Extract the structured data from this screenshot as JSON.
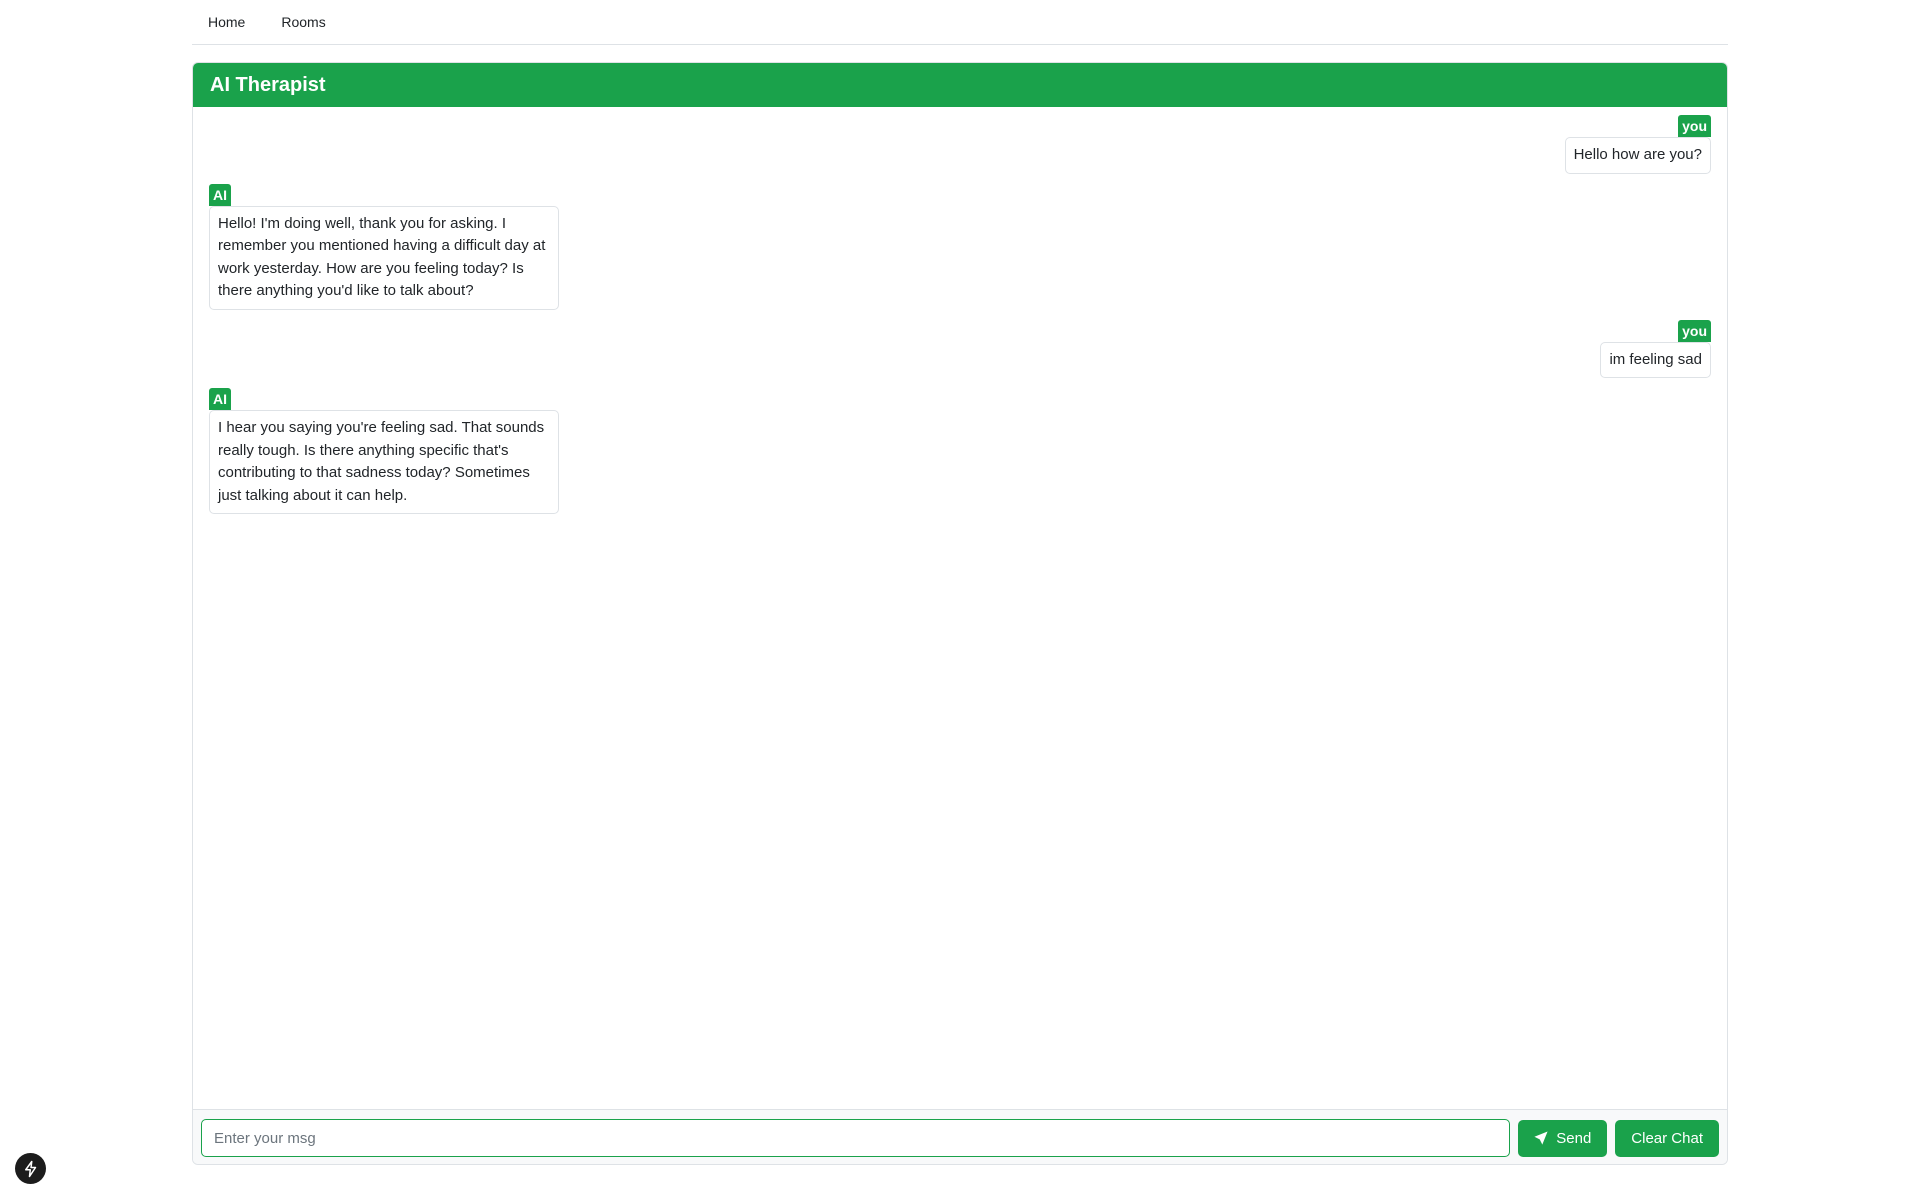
{
  "nav": {
    "items": [
      {
        "label": "Home"
      },
      {
        "label": "Rooms"
      }
    ]
  },
  "header": {
    "title": "AI Therapist"
  },
  "messages": [
    {
      "sender": "you",
      "text": "Hello how are you?"
    },
    {
      "sender": "AI",
      "text": "Hello! I'm doing well, thank you for asking. I remember you mentioned having a difficult day at work yesterday. How are you feeling today? Is there anything you'd like to talk about?"
    },
    {
      "sender": "you",
      "text": "im feeling sad"
    },
    {
      "sender": "AI",
      "text": "I hear you saying you're feeling sad. That sounds really tough. Is there anything specific that's contributing to that sadness today? Sometimes just talking about it can help."
    }
  ],
  "composer": {
    "placeholder": "Enter your msg",
    "value": "",
    "send_label": "Send",
    "clear_label": "Clear Chat"
  },
  "icons": {
    "send": "paper-plane-icon",
    "fab": "lightning-bolt-icon"
  },
  "colors": {
    "accent": "#1aa24b",
    "border": "#dee2e6"
  }
}
